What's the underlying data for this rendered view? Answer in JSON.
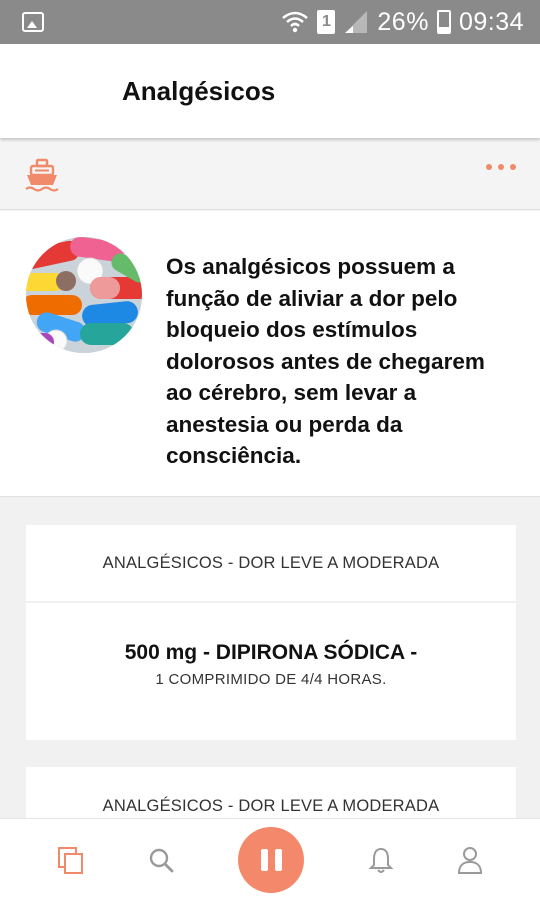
{
  "status_bar": {
    "battery_percent": "26%",
    "time": "09:34",
    "sim_slot": "1",
    "icons": [
      "gallery-icon",
      "wifi-icon",
      "sim-icon",
      "signal-icon",
      "battery-icon"
    ]
  },
  "header": {
    "title": "Analgésicos"
  },
  "toolbar": {
    "left_icon": "ship-icon",
    "right_icon": "more-options-icon"
  },
  "intro": {
    "image": "pills-photo",
    "text": "Os analgésicos possuem a função de aliviar a dor pelo bloqueio dos estímulos dolorosos antes de chegarem ao cérebro, sem levar a anestesia ou perda da consciência."
  },
  "cards": [
    {
      "category": "ANALGÉSICOS - DOR LEVE A MODERADA",
      "dose": "500 mg - DIPIRONA SÓDICA -",
      "instruction": "1 COMPRIMIDO DE 4/4 HORAS."
    },
    {
      "category": "ANALGÉSICOS - DOR LEVE A MODERADA"
    }
  ],
  "bottom_nav": {
    "items": [
      "pages-icon",
      "search-icon",
      "pause-icon",
      "bell-icon",
      "user-icon"
    ]
  },
  "colors": {
    "accent": "#f4886a",
    "status_bar": "#8a8a8a",
    "background": "#f1f1f1"
  }
}
